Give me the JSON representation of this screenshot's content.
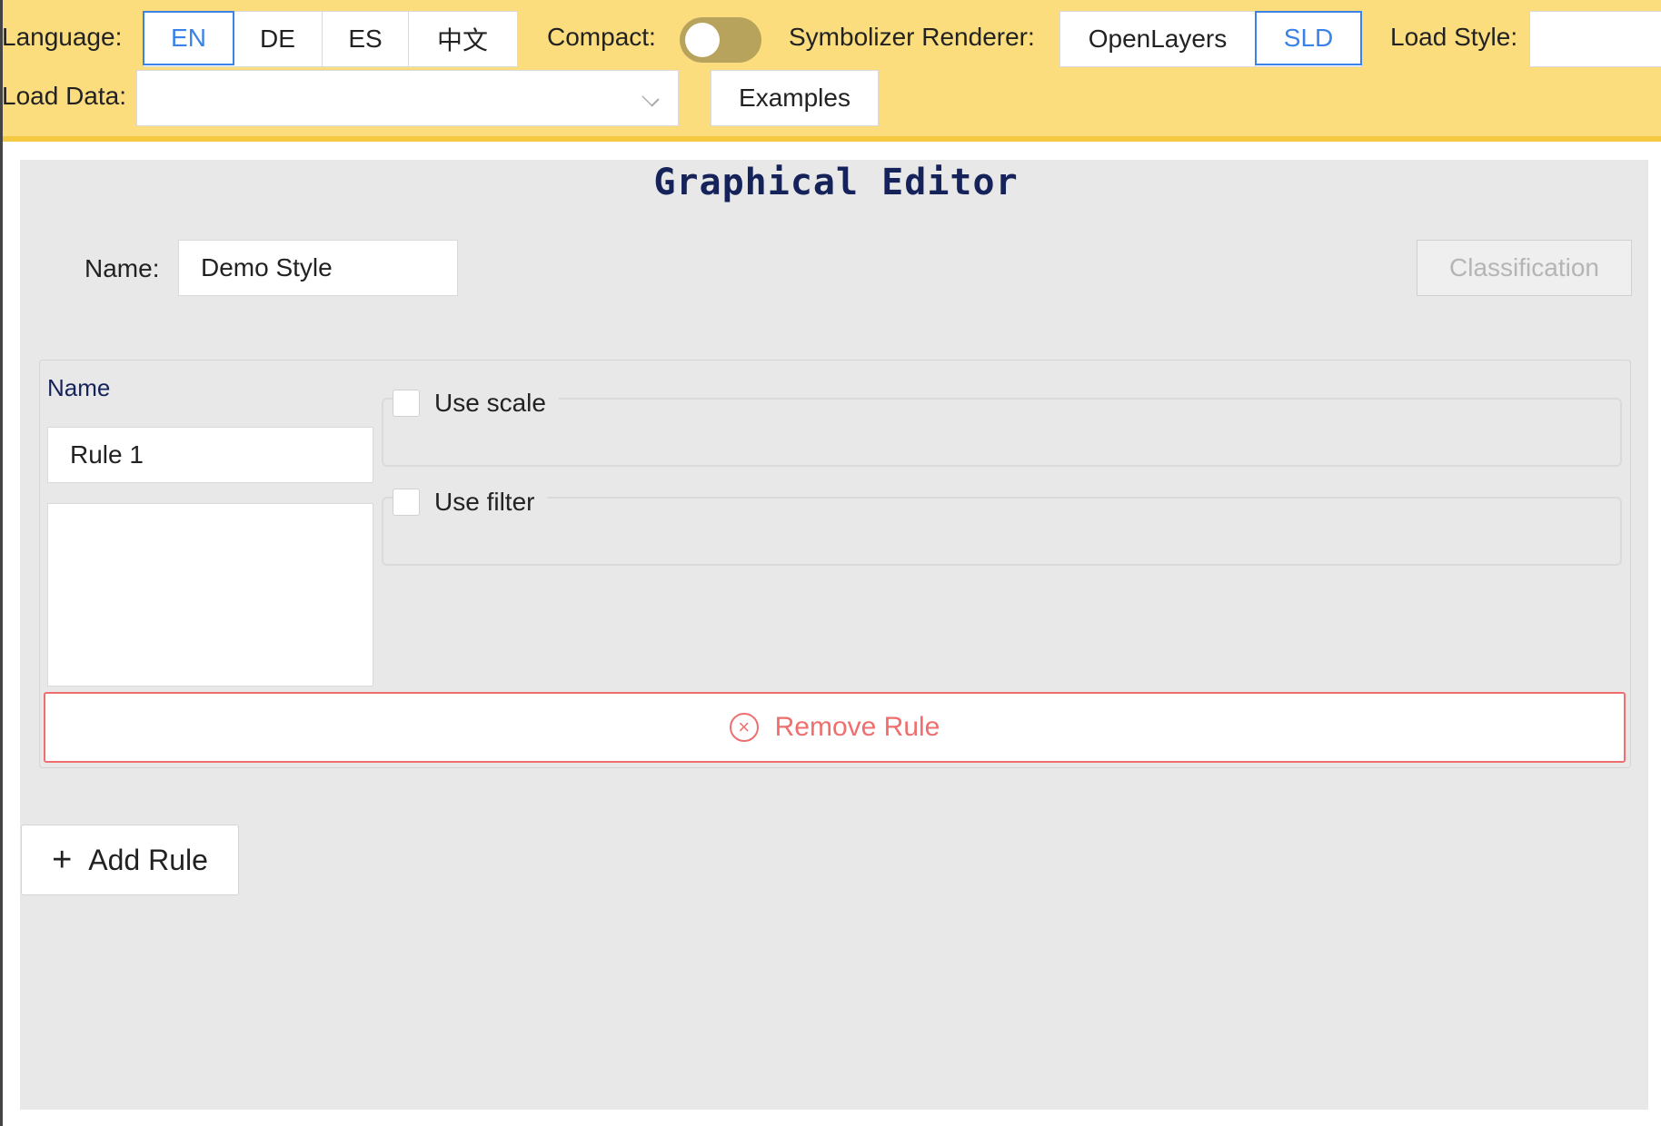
{
  "header": {
    "language_label": "Language:",
    "languages": [
      "EN",
      "DE",
      "ES",
      "中文"
    ],
    "language_selected": "EN",
    "compact_label": "Compact:",
    "compact_enabled": false,
    "renderer_label": "Symbolizer Renderer:",
    "renderers": [
      "OpenLayers",
      "SLD"
    ],
    "renderer_selected": "SLD",
    "load_style_label": "Load Style:",
    "load_style_value": "",
    "load_data_label": "Load Data:",
    "load_data_value": "",
    "examples_label": "Examples"
  },
  "editor": {
    "title": "Graphical Editor",
    "name_label": "Name:",
    "name_value": "Demo Style",
    "classification_label": "Classification"
  },
  "rule": {
    "name_label": "Name",
    "name_value": "Rule 1",
    "use_scale_label": "Use scale",
    "use_scale_checked": false,
    "use_filter_label": "Use filter",
    "use_filter_checked": false,
    "remove_label": "Remove Rule"
  },
  "add_rule_label": "Add Rule",
  "colors": {
    "header_bg": "#fbdd7e",
    "accent_blue": "#3b82e8",
    "danger": "#ef6f6f",
    "title": "#16235a",
    "panel_bg": "#e8e8e8"
  }
}
